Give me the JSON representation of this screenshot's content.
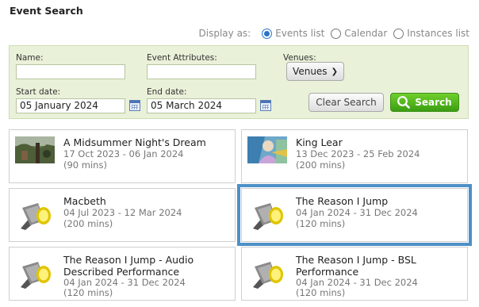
{
  "page": {
    "title": "Event Search"
  },
  "display": {
    "label": "Display as:",
    "options": [
      {
        "label": "Events list",
        "selected": true
      },
      {
        "label": "Calendar",
        "selected": false
      },
      {
        "label": "Instances list",
        "selected": false
      }
    ]
  },
  "filters": {
    "name_label": "Name:",
    "name_value": "",
    "attributes_label": "Event Attributes:",
    "attributes_value": "",
    "venues_label": "Venues:",
    "venues_button": "Venues",
    "start_label": "Start date:",
    "start_value": "05 January 2024",
    "end_label": "End date:",
    "end_value": "05 March 2024",
    "clear_label": "Clear Search",
    "search_label": "Search"
  },
  "events": [
    {
      "title": "A Midsummer Night's Dream",
      "dates": "17 Oct 2023 -  06 Jan 2024",
      "duration": "(90 mins)",
      "thumb": "photo-forest"
    },
    {
      "title": "King Lear",
      "dates": "13 Dec 2023 -  25 Feb 2024",
      "duration": "(200 mins)",
      "thumb": "photo-painting"
    },
    {
      "title": "Macbeth",
      "dates": "04 Jul 2023 -  12 Mar 2024",
      "duration": "(200 mins)",
      "thumb": "spotlight-icon"
    },
    {
      "title": "The Reason I Jump",
      "dates": "04 Jan 2024 -  31 Dec 2024",
      "duration": "(120 mins)",
      "thumb": "spotlight-icon",
      "selected": true
    },
    {
      "title": "The Reason I Jump - Audio Described Performance",
      "dates": "04 Jan 2024 -  31 Dec 2024",
      "duration": "(120 mins)",
      "thumb": "spotlight-icon"
    },
    {
      "title": "The Reason I Jump - BSL Performance",
      "dates": "04 Jan 2024 -  31 Dec 2024",
      "duration": "(120 mins)",
      "thumb": "spotlight-icon"
    }
  ],
  "colors": {
    "accent": "#2a72c9",
    "search_green": "#4caf1a",
    "panel": "#e9f1d9",
    "selected_border": "#4d90c8"
  }
}
